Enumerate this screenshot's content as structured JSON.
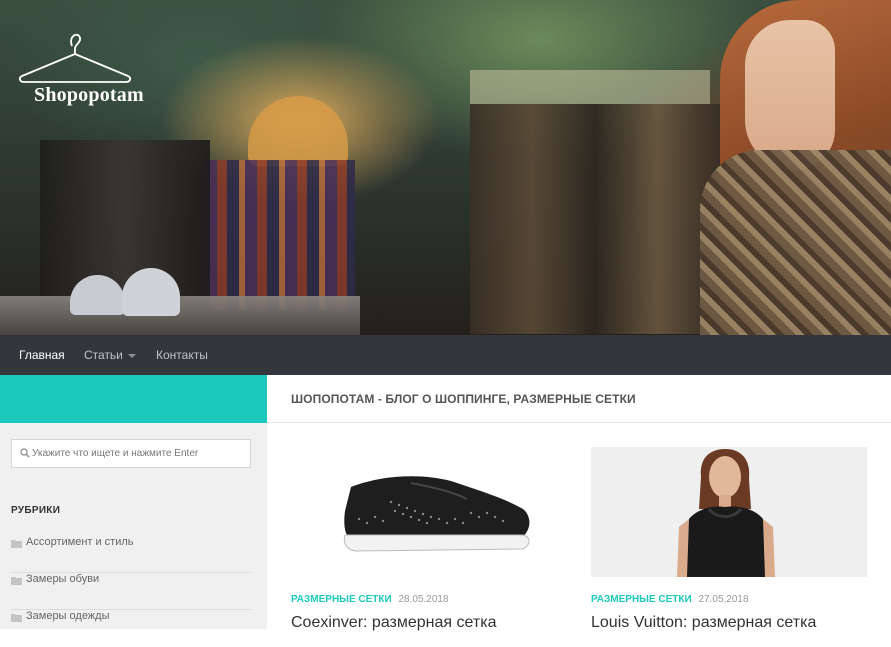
{
  "header": {
    "logo_text": "Shopopotam"
  },
  "nav": {
    "items": [
      {
        "label": "Главная",
        "active": true
      },
      {
        "label": "Статьи",
        "has_dropdown": true
      },
      {
        "label": "Контакты"
      }
    ]
  },
  "sidebar": {
    "search_placeholder": "Укажите что ищете и нажмите Enter",
    "rubrics_title": "РУБРИКИ",
    "categories": [
      {
        "label": "Ассортимент и стиль"
      },
      {
        "label": "Замеры обуви"
      },
      {
        "label": "Замеры одежды"
      }
    ]
  },
  "main": {
    "title": "ШОПОПОТАМ - БЛОГ О ШОППИНГЕ, РАЗМЕРНЫЕ СЕТКИ",
    "posts": [
      {
        "category": "РАЗМЕРНЫЕ СЕТКИ",
        "date": "28.05.2018",
        "title": "Coexinver: размерная сетка",
        "image": "black-perforated-sneaker"
      },
      {
        "category": "РАЗМЕРНЫЕ СЕТКИ",
        "date": "27.05.2018",
        "title": "Louis Vuitton: размерная сетка",
        "image": "woman-in-black-top"
      }
    ]
  },
  "colors": {
    "accent": "#1dc9bb",
    "nav_bg": "#33363b",
    "sidebar_bg": "#f0f0f0"
  }
}
